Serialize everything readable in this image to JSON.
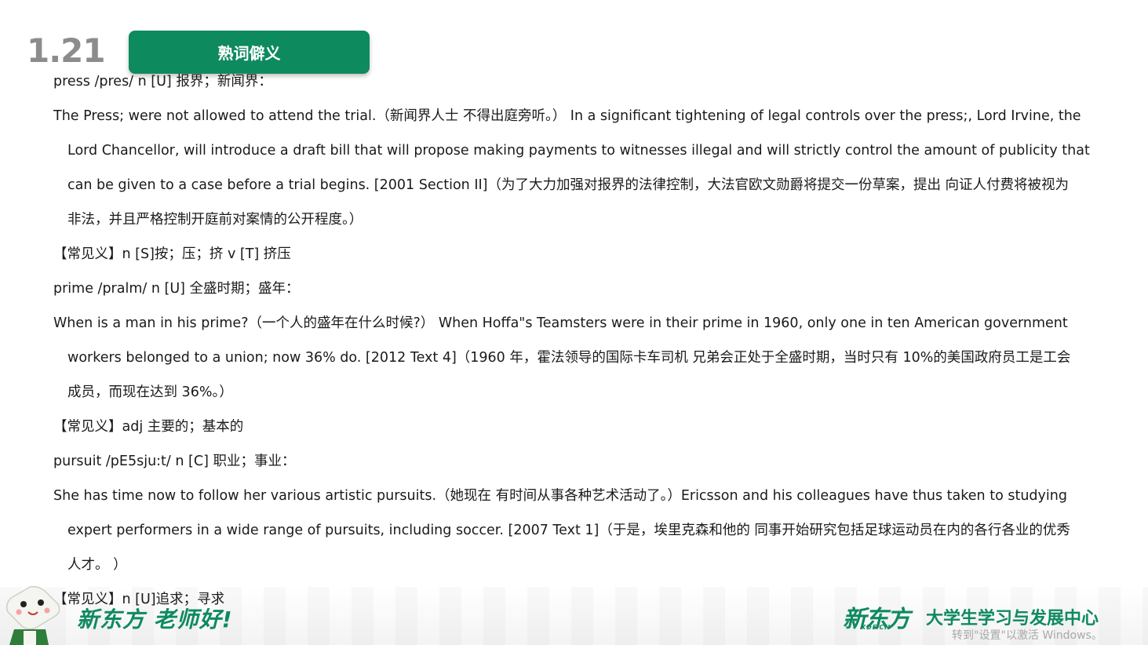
{
  "date": "1.21",
  "header": {
    "title": "熟词僻义"
  },
  "lines": [
    "press /pres/ n [U] 报界；新闻界：",
    " The Press; were not allowed to attend the trial.（新闻界人士 不得出庭旁听。）  In a significant tightening of legal controls over the press;, Lord Irvine, the",
    "Lord Chancellor, will introduce a draft bill that will propose making payments to witnesses illegal and will strictly control the amount of publicity that",
    "can be given to a case before a trial begins. [2001 Section II]（为了大力加强对报界的法律控制，大法官欧文勋爵将提交一份草案，提出 向证人付费将被视为",
    "非法，并且严格控制开庭前对案情的公开程度。）",
    "【常见义】n [S]按；压；挤 v [T] 挤压",
    "prime /pralm/ n [U] 全盛时期；盛年：",
    "When is a man in his prime?（一个人的盛年在什么时候?）  When Hoffa\"s Teamsters were in their prime in 1960, only one in ten American government",
    "workers belonged to a union; now 36% do. [2012 Text 4]（1960 年，霍法领导的国际卡车司机 兄弟会正处于全盛时期，当时只有 10%的美国政府员工是工会",
    "成员，而现在达到 36%。）",
    " 【常见义】adj 主要的；基本的",
    "pursuit /pE5sju:t/ n [C] 职业；事业：",
    "She has time now to follow her various artistic pursuits.（她现在 有时间从事各种艺术活动了。）Ericsson and his colleagues have thus taken to studying",
    "expert performers in a wide range of pursuits, including soccer. [2007 Text 1]（于是，埃里克森和他的 同事开始研究包括足球运动员在内的各行各业的优秀",
    "人才。 ）",
    "【常见义】n [U]追求；寻求"
  ],
  "footer": {
    "slogan": "新东方 老师好!",
    "logo": "新东方",
    "logo_sub": "XDF.CN",
    "center_name": "大学生学习与发展中心",
    "activation_notice": "转到\"设置\"以激活 Windows。"
  },
  "colors": {
    "brand_green": "#0e8a5f",
    "date_gray": "#8c8c8c"
  }
}
